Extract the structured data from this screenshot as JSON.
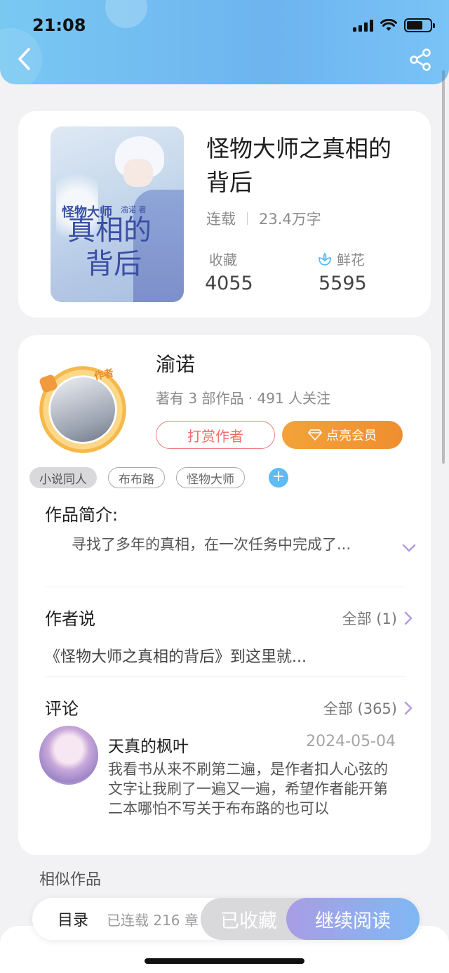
{
  "status_bar": {
    "time": "21:08"
  },
  "book": {
    "title": "怪物大师之真相的背后",
    "status": "连载",
    "word_count": "23.4万字",
    "favorites_label": "收藏",
    "favorites_value": "4055",
    "flowers_label": "鲜花",
    "flowers_value": "5595",
    "cover_text_small": "怪物大师",
    "cover_text_line1": "真相的",
    "cover_text_line2": "背后",
    "cover_author": "渝诺 著"
  },
  "author": {
    "name": "渝诺",
    "badge": "作者",
    "stats": "著有 3 部作品 · 491 人关注",
    "tip_button": "打赏作者",
    "vip_button": "点亮会员"
  },
  "tags": [
    "小说同人",
    "布布路",
    "怪物大师"
  ],
  "intro": {
    "heading": "作品简介:",
    "text": "寻找了多年的真相，在一次任务中完成了..."
  },
  "author_say": {
    "heading": "作者说",
    "more": "全部 (1)",
    "text": "《怪物大师之真相的背后》到这里就..."
  },
  "comments": {
    "heading": "评论",
    "more": "全部 (365)",
    "items": [
      {
        "user": "天真的枫叶",
        "date": "2024-05-04",
        "text": "我看书从来不刷第二遍，是作者扣人心弦的文字让我刷了一遍又一遍，希望作者能开第二本哪怕不写关于布布路的也可以"
      }
    ]
  },
  "similar": {
    "heading": "相似作品"
  },
  "bottom_bar": {
    "toc": "目录",
    "chapters": "已连载 216 章",
    "favorite_button": "已收藏",
    "read_button": "继续阅读"
  },
  "colors": {
    "header_gradient_start": "#79c8f2",
    "accent_orange": "#ef8e2f",
    "tip_red": "#ee6f6a",
    "read_gradient_start": "#a99de6",
    "read_gradient_end": "#7fb8f3",
    "flower_blue": "#5cbcf3"
  },
  "icons": {
    "back": "chevron-left-icon",
    "share": "share-icon",
    "flower": "flower-icon",
    "diamond": "diamond-icon",
    "expand": "chevron-down-icon",
    "more": "chevron-right-icon",
    "add_tag": "plus-icon"
  }
}
